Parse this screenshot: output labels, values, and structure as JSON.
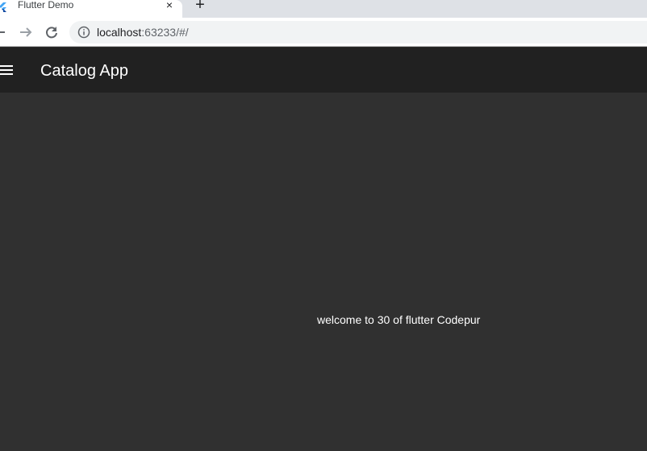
{
  "browser": {
    "tab": {
      "title": "Flutter Demo",
      "close_label": "×",
      "new_tab_label": "+"
    },
    "address_bar": {
      "host": "localhost",
      "rest": ":63233/#/"
    },
    "icons": {
      "favicon": "flutter-logo-icon",
      "back": "arrow-left-icon",
      "forward": "arrow-right-icon",
      "reload": "reload-icon",
      "info": "info-icon"
    }
  },
  "app": {
    "app_bar": {
      "title": "Catalog App",
      "menu_icon": "hamburger-menu-icon"
    },
    "body": {
      "text": "welcome to 30 of flutter Codepur"
    },
    "colors": {
      "app_bar_bg": "#212121",
      "body_bg": "#303030",
      "text": "#ffffff"
    }
  }
}
